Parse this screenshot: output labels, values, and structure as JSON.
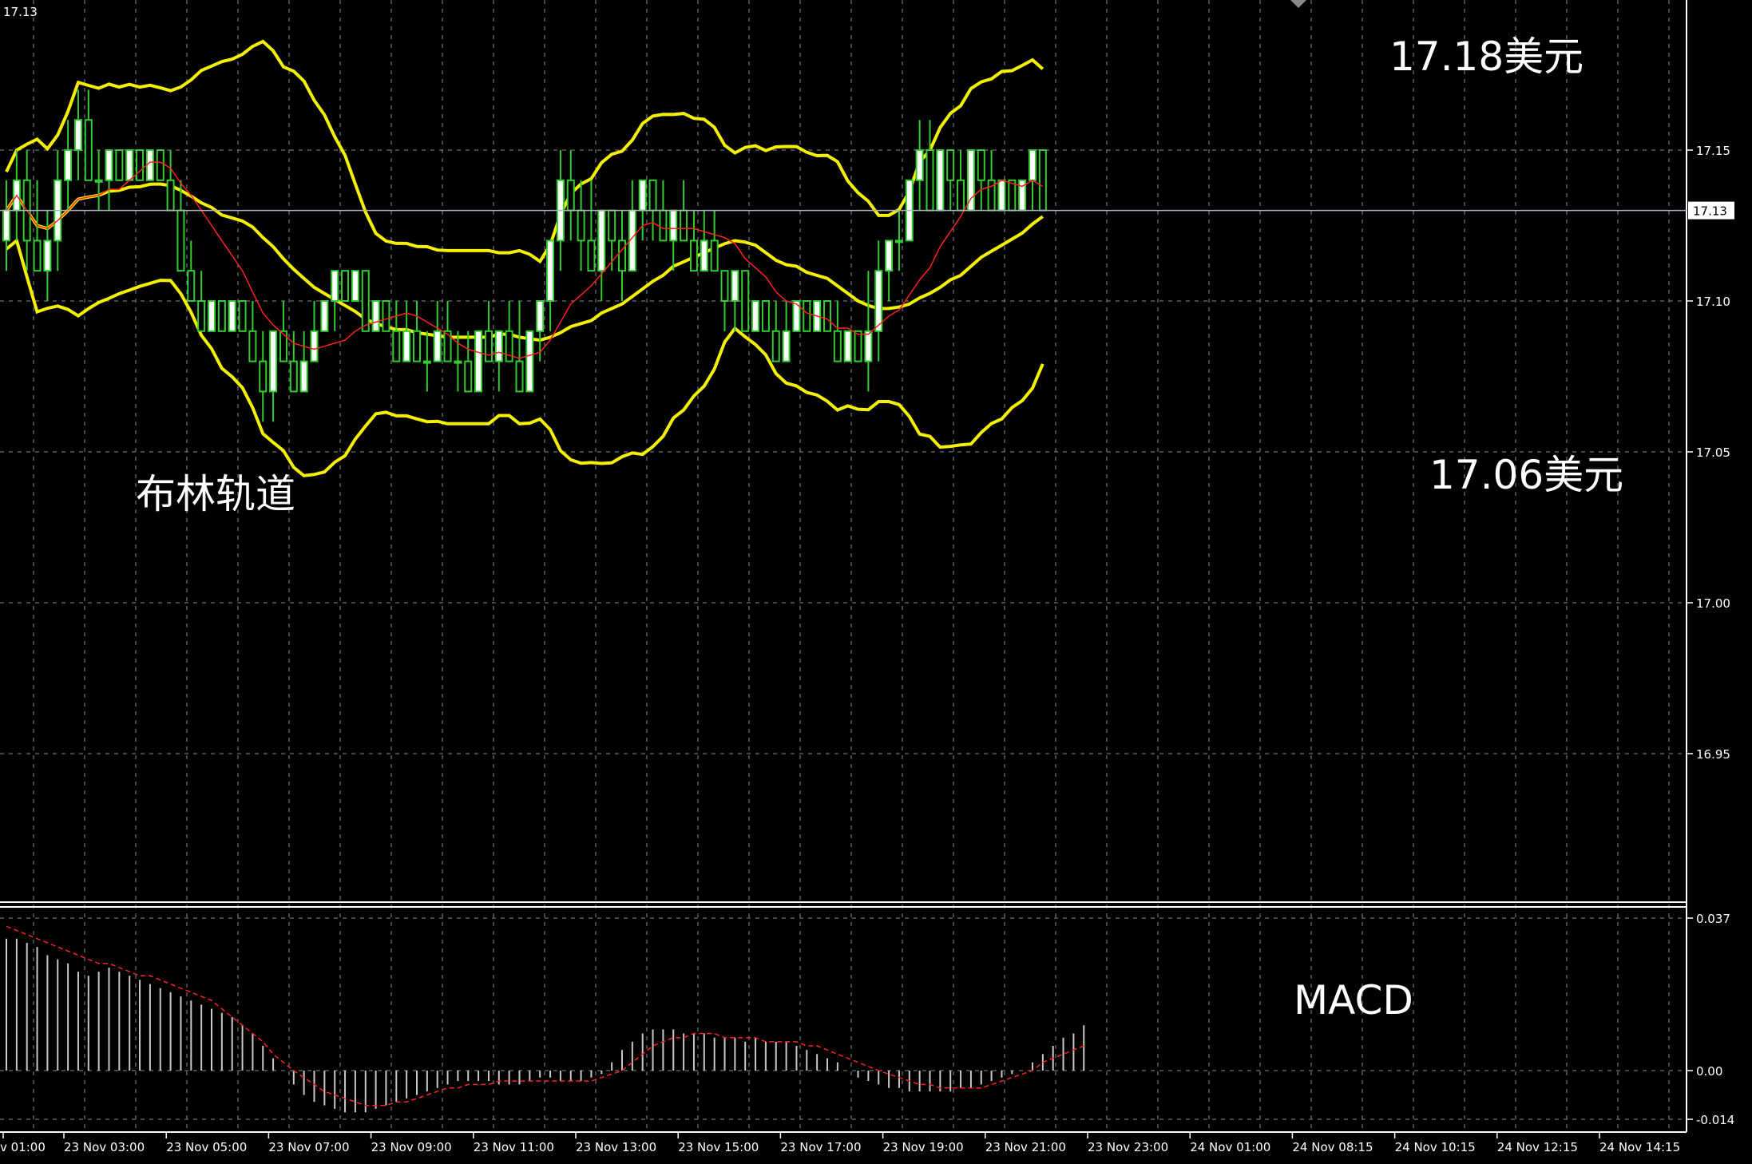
{
  "chart_data": [
    {
      "type": "candlestick",
      "panel": "price",
      "symbol_label": "17.13",
      "current_price": 17.13,
      "ylim": [
        16.9,
        17.2
      ],
      "yticks": [
        "17.15",
        "17.10",
        "17.05",
        "17.00",
        "16.95"
      ],
      "ytick_values": [
        17.15,
        17.1,
        17.05,
        17.0,
        16.95
      ],
      "annotations": {
        "upper": "17.18美元",
        "lower": "17.06美元",
        "indicator": "布林轨道"
      },
      "ohlc": [
        [
          17.12,
          17.14,
          17.11,
          17.13
        ],
        [
          17.13,
          17.15,
          17.12,
          17.14
        ],
        [
          17.14,
          17.15,
          17.11,
          17.12
        ],
        [
          17.12,
          17.14,
          17.11,
          17.11
        ],
        [
          17.11,
          17.13,
          17.1,
          17.12
        ],
        [
          17.12,
          17.15,
          17.11,
          17.14
        ],
        [
          17.14,
          17.16,
          17.13,
          17.15
        ],
        [
          17.15,
          17.17,
          17.14,
          17.16
        ],
        [
          17.16,
          17.17,
          17.14,
          17.14
        ],
        [
          17.14,
          17.15,
          17.13,
          17.14
        ],
        [
          17.14,
          17.15,
          17.13,
          17.15
        ],
        [
          17.15,
          17.15,
          17.14,
          17.14
        ],
        [
          17.14,
          17.15,
          17.14,
          17.15
        ],
        [
          17.15,
          17.15,
          17.14,
          17.14
        ],
        [
          17.14,
          17.15,
          17.14,
          17.15
        ],
        [
          17.15,
          17.15,
          17.14,
          17.14
        ],
        [
          17.14,
          17.15,
          17.13,
          17.13
        ],
        [
          17.13,
          17.14,
          17.11,
          17.11
        ],
        [
          17.11,
          17.12,
          17.1,
          17.1
        ],
        [
          17.1,
          17.11,
          17.09,
          17.09
        ],
        [
          17.09,
          17.1,
          17.09,
          17.1
        ],
        [
          17.1,
          17.1,
          17.09,
          17.09
        ],
        [
          17.09,
          17.1,
          17.09,
          17.1
        ],
        [
          17.1,
          17.1,
          17.09,
          17.09
        ],
        [
          17.09,
          17.1,
          17.08,
          17.08
        ],
        [
          17.08,
          17.09,
          17.06,
          17.07
        ],
        [
          17.07,
          17.09,
          17.06,
          17.09
        ],
        [
          17.09,
          17.1,
          17.08,
          17.08
        ],
        [
          17.08,
          17.09,
          17.07,
          17.07
        ],
        [
          17.07,
          17.09,
          17.07,
          17.08
        ],
        [
          17.08,
          17.1,
          17.08,
          17.09
        ],
        [
          17.09,
          17.1,
          17.09,
          17.1
        ],
        [
          17.1,
          17.11,
          17.09,
          17.11
        ],
        [
          17.11,
          17.11,
          17.1,
          17.1
        ],
        [
          17.1,
          17.11,
          17.1,
          17.11
        ],
        [
          17.11,
          17.11,
          17.09,
          17.09
        ],
        [
          17.09,
          17.1,
          17.09,
          17.1
        ],
        [
          17.1,
          17.1,
          17.09,
          17.09
        ],
        [
          17.09,
          17.1,
          17.08,
          17.08
        ],
        [
          17.08,
          17.1,
          17.08,
          17.09
        ],
        [
          17.09,
          17.1,
          17.08,
          17.08
        ],
        [
          17.08,
          17.09,
          17.07,
          17.08
        ],
        [
          17.08,
          17.1,
          17.08,
          17.09
        ],
        [
          17.09,
          17.1,
          17.08,
          17.08
        ],
        [
          17.08,
          17.09,
          17.07,
          17.08
        ],
        [
          17.08,
          17.09,
          17.07,
          17.07
        ],
        [
          17.07,
          17.09,
          17.07,
          17.09
        ],
        [
          17.09,
          17.1,
          17.08,
          17.08
        ],
        [
          17.08,
          17.09,
          17.07,
          17.09
        ],
        [
          17.09,
          17.1,
          17.08,
          17.08
        ],
        [
          17.08,
          17.1,
          17.07,
          17.07
        ],
        [
          17.07,
          17.09,
          17.07,
          17.09
        ],
        [
          17.09,
          17.1,
          17.08,
          17.1
        ],
        [
          17.1,
          17.12,
          17.09,
          17.12
        ],
        [
          17.12,
          17.15,
          17.11,
          17.14
        ],
        [
          17.14,
          17.15,
          17.12,
          17.13
        ],
        [
          17.13,
          17.14,
          17.11,
          17.12
        ],
        [
          17.12,
          17.14,
          17.11,
          17.11
        ],
        [
          17.11,
          17.13,
          17.1,
          17.13
        ],
        [
          17.13,
          17.13,
          17.11,
          17.12
        ],
        [
          17.12,
          17.13,
          17.1,
          17.11
        ],
        [
          17.11,
          17.14,
          17.11,
          17.13
        ],
        [
          17.13,
          17.14,
          17.12,
          17.14
        ],
        [
          17.14,
          17.14,
          17.12,
          17.13
        ],
        [
          17.13,
          17.14,
          17.12,
          17.12
        ],
        [
          17.12,
          17.13,
          17.11,
          17.13
        ],
        [
          17.13,
          17.14,
          17.12,
          17.12
        ],
        [
          17.12,
          17.13,
          17.11,
          17.11
        ],
        [
          17.11,
          17.13,
          17.11,
          17.12
        ],
        [
          17.12,
          17.13,
          17.11,
          17.11
        ],
        [
          17.11,
          17.11,
          17.09,
          17.1
        ],
        [
          17.1,
          17.11,
          17.09,
          17.11
        ],
        [
          17.11,
          17.11,
          17.09,
          17.09
        ],
        [
          17.09,
          17.1,
          17.09,
          17.1
        ],
        [
          17.1,
          17.1,
          17.09,
          17.09
        ],
        [
          17.09,
          17.1,
          17.08,
          17.08
        ],
        [
          17.08,
          17.1,
          17.08,
          17.09
        ],
        [
          17.09,
          17.1,
          17.09,
          17.1
        ],
        [
          17.1,
          17.1,
          17.09,
          17.09
        ],
        [
          17.09,
          17.1,
          17.09,
          17.1
        ],
        [
          17.1,
          17.1,
          17.09,
          17.09
        ],
        [
          17.09,
          17.1,
          17.08,
          17.08
        ],
        [
          17.08,
          17.09,
          17.08,
          17.09
        ],
        [
          17.09,
          17.09,
          17.08,
          17.08
        ],
        [
          17.08,
          17.11,
          17.07,
          17.09
        ],
        [
          17.09,
          17.12,
          17.08,
          17.11
        ],
        [
          17.11,
          17.12,
          17.1,
          17.12
        ],
        [
          17.12,
          17.13,
          17.11,
          17.12
        ],
        [
          17.12,
          17.14,
          17.12,
          17.14
        ],
        [
          17.14,
          17.16,
          17.13,
          17.15
        ],
        [
          17.15,
          17.16,
          17.13,
          17.13
        ],
        [
          17.13,
          17.15,
          17.13,
          17.15
        ],
        [
          17.15,
          17.15,
          17.13,
          17.14
        ],
        [
          17.14,
          17.15,
          17.13,
          17.13
        ],
        [
          17.13,
          17.15,
          17.13,
          17.15
        ],
        [
          17.15,
          17.15,
          17.13,
          17.14
        ],
        [
          17.14,
          17.15,
          17.13,
          17.13
        ],
        [
          17.13,
          17.14,
          17.13,
          17.14
        ],
        [
          17.14,
          17.14,
          17.13,
          17.13
        ],
        [
          17.13,
          17.14,
          17.13,
          17.14
        ],
        [
          17.14,
          17.15,
          17.13,
          17.15
        ],
        [
          17.15,
          17.15,
          17.13,
          17.13
        ]
      ]
    },
    {
      "type": "macd",
      "panel": "indicator",
      "label": "MACD",
      "ylim": [
        -0.016,
        0.04
      ],
      "yticks": [
        "0.037",
        "0.00",
        "-0.014"
      ],
      "ytick_values": [
        0.037,
        0.0,
        -0.014
      ],
      "histogram": [
        0.032,
        0.032,
        0.031,
        0.03,
        0.028,
        0.027,
        0.026,
        0.024,
        0.023,
        0.024,
        0.025,
        0.024,
        0.023,
        0.022,
        0.021,
        0.02,
        0.019,
        0.018,
        0.017,
        0.016,
        0.015,
        0.014,
        0.013,
        0.011,
        0.009,
        0.006,
        0.003,
        0.0,
        -0.004,
        -0.007,
        -0.009,
        -0.01,
        -0.011,
        -0.012,
        -0.012,
        -0.012,
        -0.011,
        -0.01,
        -0.009,
        -0.008,
        -0.007,
        -0.006,
        -0.005,
        -0.004,
        -0.003,
        -0.003,
        -0.003,
        -0.003,
        -0.004,
        -0.004,
        -0.004,
        -0.003,
        -0.002,
        -0.002,
        -0.003,
        -0.003,
        -0.003,
        -0.002,
        -0.001,
        0.002,
        0.005,
        0.007,
        0.009,
        0.01,
        0.01,
        0.01,
        0.009,
        0.009,
        0.009,
        0.008,
        0.008,
        0.008,
        0.007,
        0.008,
        0.007,
        0.007,
        0.007,
        0.006,
        0.005,
        0.004,
        0.003,
        0.002,
        0.0,
        -0.002,
        -0.003,
        -0.004,
        -0.005,
        -0.005,
        -0.006,
        -0.006,
        -0.006,
        -0.006,
        -0.006,
        -0.005,
        -0.005,
        -0.004,
        -0.003,
        -0.002,
        -0.001,
        0.0,
        0.002,
        0.004,
        0.006,
        0.008,
        0.009,
        0.011
      ],
      "signal": [
        0.035,
        0.034,
        0.033,
        0.032,
        0.031,
        0.03,
        0.029,
        0.028,
        0.027,
        0.026,
        0.026,
        0.025,
        0.024,
        0.023,
        0.023,
        0.022,
        0.021,
        0.02,
        0.019,
        0.018,
        0.017,
        0.015,
        0.013,
        0.011,
        0.009,
        0.007,
        0.004,
        0.002,
        0.0,
        -0.002,
        -0.004,
        -0.006,
        -0.007,
        -0.008,
        -0.009,
        -0.01,
        -0.01,
        -0.01,
        -0.009,
        -0.009,
        -0.008,
        -0.007,
        -0.006,
        -0.005,
        -0.005,
        -0.004,
        -0.004,
        -0.004,
        -0.003,
        -0.003,
        -0.003,
        -0.003,
        -0.003,
        -0.003,
        -0.003,
        -0.003,
        -0.003,
        -0.003,
        -0.002,
        -0.001,
        0.0,
        0.002,
        0.004,
        0.006,
        0.007,
        0.008,
        0.008,
        0.009,
        0.009,
        0.009,
        0.008,
        0.008,
        0.008,
        0.008,
        0.007,
        0.007,
        0.007,
        0.007,
        0.006,
        0.006,
        0.005,
        0.004,
        0.003,
        0.002,
        0.001,
        0.0,
        -0.001,
        -0.002,
        -0.003,
        -0.004,
        -0.004,
        -0.005,
        -0.005,
        -0.005,
        -0.005,
        -0.005,
        -0.004,
        -0.003,
        -0.002,
        -0.001,
        0.0,
        0.002,
        0.003,
        0.004,
        0.005,
        0.006
      ]
    }
  ],
  "x_labels": [
    "v 01:00",
    "23 Nov 03:00",
    "23 Nov 05:00",
    "23 Nov 07:00",
    "23 Nov 09:00",
    "23 Nov 11:00",
    "23 Nov 13:00",
    "23 Nov 15:00",
    "23 Nov 17:00",
    "23 Nov 19:00",
    "23 Nov 21:00",
    "23 Nov 23:00",
    "24 Nov 01:00",
    "24 Nov 08:15",
    "24 Nov 10:15",
    "24 Nov 12:15",
    "24 Nov 14:15"
  ],
  "colors": {
    "background": "#000000",
    "grid": "#8a8a9a",
    "candle": "#33cc33",
    "candle_body": "#ffffff",
    "bollinger": "#f5f000",
    "ma": "#ff2020",
    "macd_hist": "#c8c8c8",
    "macd_signal": "#ff2020",
    "text": "#ffffff"
  }
}
